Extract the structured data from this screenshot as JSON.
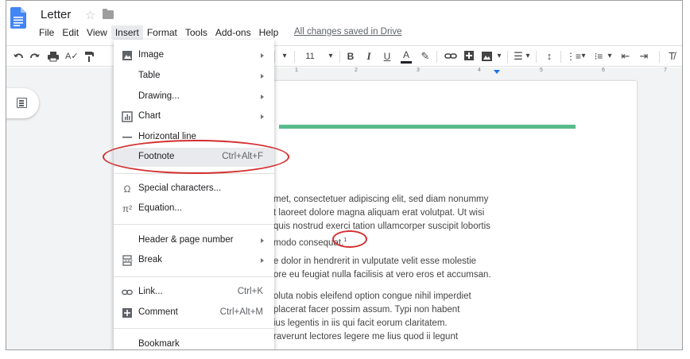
{
  "app": {
    "title": "Letter",
    "save_status": "All changes saved in Drive"
  },
  "icons": {
    "logo": "google-docs-icon",
    "star": "star-icon",
    "folder": "folder-icon"
  },
  "menubar": [
    {
      "label": "File"
    },
    {
      "label": "Edit"
    },
    {
      "label": "View"
    },
    {
      "label": "Insert",
      "active": true
    },
    {
      "label": "Format"
    },
    {
      "label": "Tools"
    },
    {
      "label": "Add-ons"
    },
    {
      "label": "Help"
    }
  ],
  "toolbar": {
    "font_size": "11",
    "bold": "B",
    "italic": "I",
    "underline": "U",
    "text_color": "A"
  },
  "ruler": {
    "numbers": [
      "1",
      "2",
      "3",
      "4",
      "5",
      "6",
      "7"
    ]
  },
  "insert_menu": {
    "items": [
      {
        "label": "Image",
        "icon": "image-icon",
        "submenu": true
      },
      {
        "label": "Table",
        "submenu": true
      },
      {
        "label": "Drawing...",
        "submenu": true
      },
      {
        "label": "Chart",
        "icon": "chart-icon",
        "submenu": true
      },
      {
        "label": "Horizontal line",
        "icon": "horizontal-line-icon"
      },
      {
        "label": "Footnote",
        "shortcut": "Ctrl+Alt+F",
        "highlighted": true
      },
      {
        "label": "Special characters...",
        "icon": "omega-icon"
      },
      {
        "label": "Equation...",
        "icon": "pi-icon"
      },
      {
        "label": "Header & page number",
        "submenu": true
      },
      {
        "label": "Break",
        "icon": "page-break-icon",
        "submenu": true
      },
      {
        "label": "Link...",
        "icon": "link-icon",
        "shortcut": "Ctrl+K"
      },
      {
        "label": "Comment",
        "icon": "add-comment-icon",
        "shortcut": "Ctrl+Alt+M"
      },
      {
        "label": "Bookmark"
      }
    ]
  },
  "document": {
    "para1": [
      "met, consectetuer adipiscing elit, sed diam nonummy",
      "t laoreet dolore magna aliquam erat volutpat. Ut wisi",
      "quis nostrud exerci tation ullamcorper suscipit lobortis",
      "modo consequat."
    ],
    "footnote_mark": "1",
    "para2": [
      "e dolor in hendrerit in vulputate velit esse molestie",
      "ore eu feugiat nulla facilisis at vero eros et accumsan."
    ],
    "para3": [
      "oluta nobis eleifend option congue nihil imperdiet",
      "placerat facer possim assum. Typi non habent",
      "ius legentis in iis qui facit eorum claritatem.",
      "raverunt lectores legere me lius quod ii legunt"
    ]
  },
  "colors": {
    "accent_green": "#57bb8a",
    "annotation_red": "#d32f2f",
    "docs_blue": "#4285f4"
  }
}
